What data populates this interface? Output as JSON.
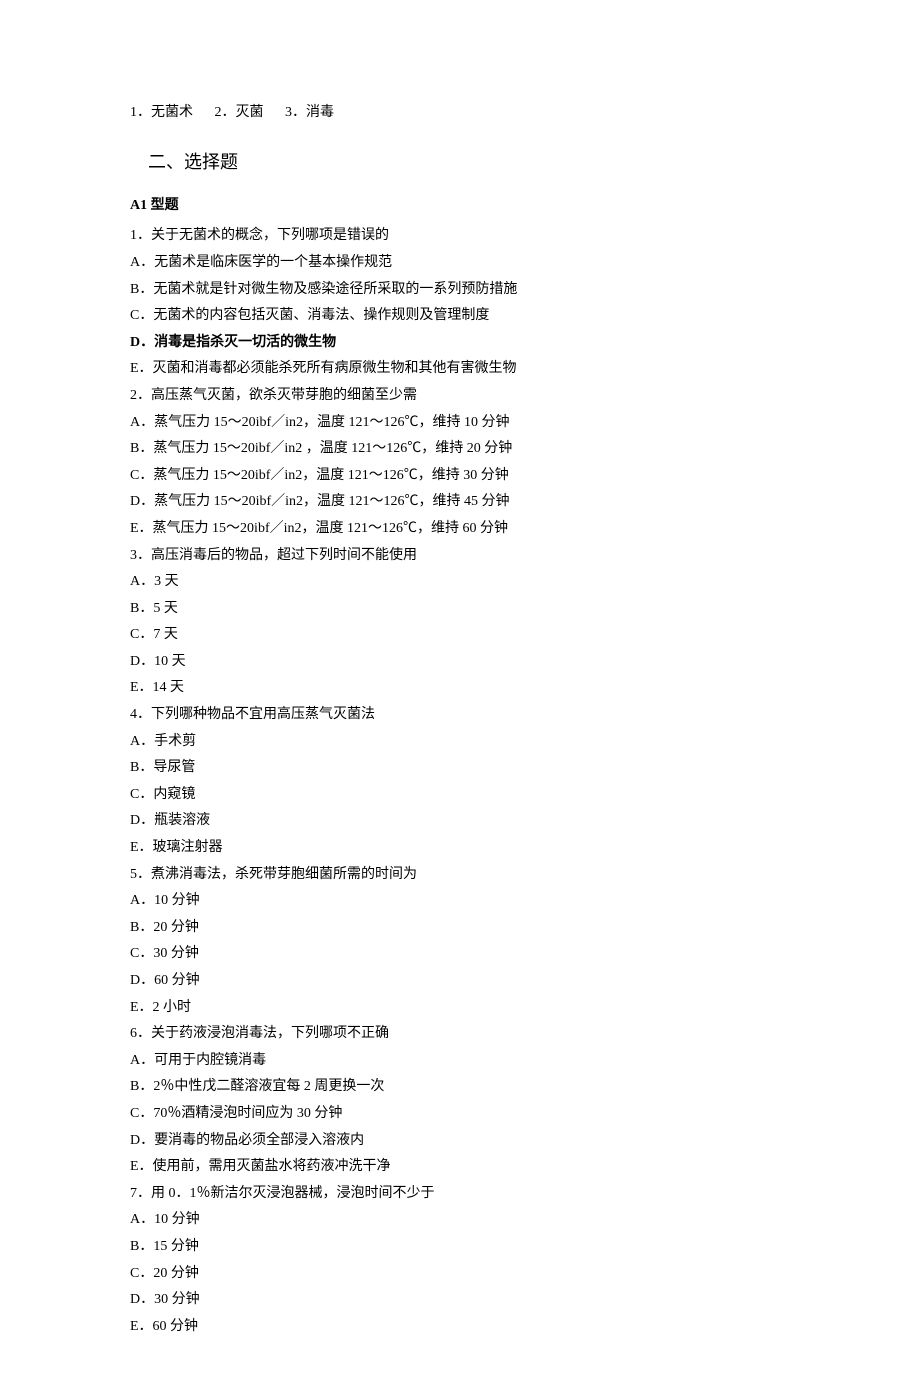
{
  "terms": [
    {
      "num": "1．",
      "text": "无菌术"
    },
    {
      "num": "2．",
      "text": "灭菌"
    },
    {
      "num": "3．",
      "text": "消毒"
    }
  ],
  "section2": {
    "title": "二、选择题"
  },
  "a1": {
    "label": "A1 型题"
  },
  "q1": {
    "stem": "1．关于无菌术的概念，下列哪项是错误的",
    "A": "A．无菌术是临床医学的一个基本操作规范",
    "B": "B．无菌术就是针对微生物及感染途径所采取的一系列预防措施",
    "C": "C．无菌术的内容包括灭菌、消毒法、操作规则及管理制度",
    "D": "D．消毒是指杀灭一切活的微生物",
    "E": "E．灭菌和消毒都必须能杀死所有病原微生物和其他有害微生物"
  },
  "q2": {
    "stem": "2．高压蒸气灭菌，欲杀灭带芽胞的细菌至少需",
    "A": "A．蒸气压力 15～20ibf／in2，温度 121～126℃，维持 10 分钟",
    "B": "B．蒸气压力 15～20ibf／in2 ，温度 121～126℃，维持 20 分钟",
    "C": "C．蒸气压力 15～20ibf／in2，温度 121～126℃，维持 30 分钟",
    "D": "D．蒸气压力 15～20ibf／in2，温度 121～126℃，维持 45 分钟",
    "E": "E．蒸气压力 15～20ibf／in2，温度 121～126℃，维持 60 分钟"
  },
  "q3": {
    "stem": "3．高压消毒后的物品，超过下列时间不能使用",
    "A": "A．3 天",
    "B": "B．5 天",
    "C": "C．7 天",
    "D": "D．10 天",
    "E": "E．14 天"
  },
  "q4": {
    "stem": "4．下列哪种物品不宜用高压蒸气灭菌法",
    "A": "A．手术剪",
    "B": "B．导尿管",
    "C": "C．内窥镜",
    "D": "D．瓶装溶液",
    "E": "E．玻璃注射器"
  },
  "q5": {
    "stem": "5．煮沸消毒法，杀死带芽胞细菌所需的时间为",
    "A": "A．10 分钟",
    "B": "B．20 分钟",
    "C": "C．30 分钟",
    "D": "D．60 分钟",
    "E": "E．2 小时"
  },
  "q6": {
    "stem": "6．关于药液浸泡消毒法，下列哪项不正确",
    "A": "A．可用于内腔镜消毒",
    "B": "B．2％中性戊二醛溶液宜每 2 周更换一次",
    "C": "C．70％酒精浸泡时间应为 30 分钟",
    "D": "D．要消毒的物品必须全部浸入溶液内",
    "E": "E．使用前，需用灭菌盐水将药液冲洗干净"
  },
  "q7": {
    "stem": "7．用 0．1％新洁尔灭浸泡器械，浸泡时间不少于",
    "A": "A．10 分钟",
    "B": "B．15 分钟",
    "C": "C．20 分钟",
    "D": "D．30 分钟",
    "E": "E．60 分钟"
  }
}
